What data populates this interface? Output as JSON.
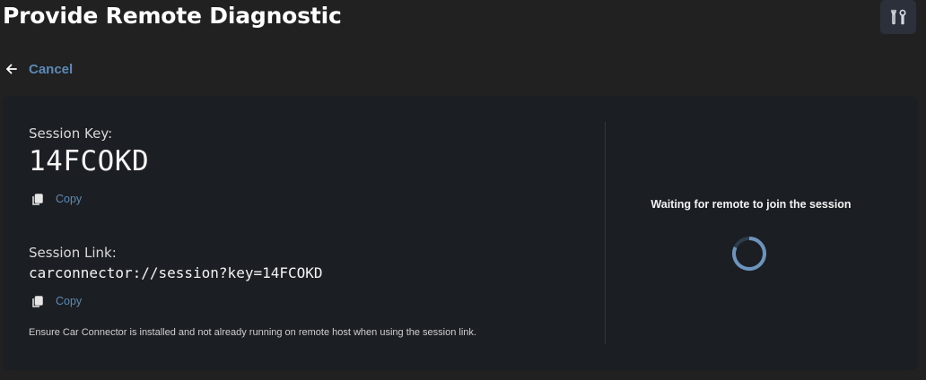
{
  "header": {
    "title": "Provide Remote Diagnostic",
    "tools_icon": "tools-icon"
  },
  "nav": {
    "back_icon": "arrow-left-icon",
    "cancel_label": "Cancel"
  },
  "session": {
    "key_label": "Session Key:",
    "key_value": "14FCOKD",
    "key_copy_label": "Copy",
    "link_label": "Session Link:",
    "link_value": "carconnector://session?key=14FCOKD",
    "link_copy_label": "Copy",
    "hint": "Ensure Car Connector is installed and not already running on remote host when using the session link."
  },
  "status": {
    "waiting_text": "Waiting for remote to join the session",
    "spinner_icon": "loading-spinner-icon"
  },
  "colors": {
    "background": "#212121",
    "card": "#1b1e22",
    "accent": "#5b8ab8",
    "tools_button_bg": "#2b303a"
  }
}
